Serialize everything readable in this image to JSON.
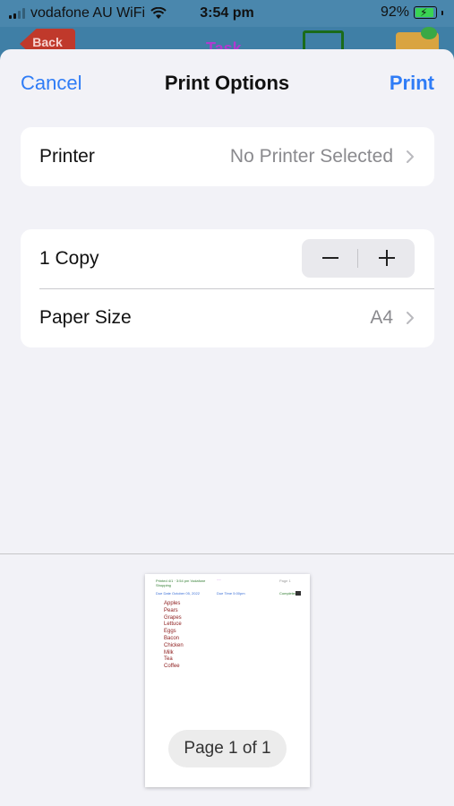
{
  "status_bar": {
    "carrier": "vodafone AU WiFi",
    "time": "3:54 pm",
    "battery": "92%",
    "battery_level": 0.92
  },
  "background_app": {
    "back_label": "Back",
    "title": "Task"
  },
  "nav": {
    "cancel_label": "Cancel",
    "title": "Print Options",
    "print_label": "Print"
  },
  "printer": {
    "label": "Printer",
    "value": "No Printer Selected"
  },
  "copies": {
    "label": "1 Copy"
  },
  "paper_size": {
    "label": "Paper Size",
    "value": "A4"
  },
  "preview": {
    "header_left": "Printed 4/1 · 3:54 pm Vodafone",
    "header_left2": "Shopping",
    "header_sub": "Due Date   October 05, 2022",
    "header_sub_mid": "Due Time  5:00pm",
    "page_right": "Page 1",
    "completed": "Completed",
    "items": [
      "Apples",
      "Pears",
      "Grapes",
      "Lettuce",
      "Eggs",
      "Bacon",
      "Chicken",
      "Milk",
      "Tea",
      "Coffee"
    ],
    "page_indicator": "Page 1 of 1"
  },
  "colors": {
    "accent": "#2f7cf6",
    "sheet_bg": "#f2f2f7",
    "card_bg": "#ffffff",
    "secondary_text": "#8a8a8e"
  }
}
